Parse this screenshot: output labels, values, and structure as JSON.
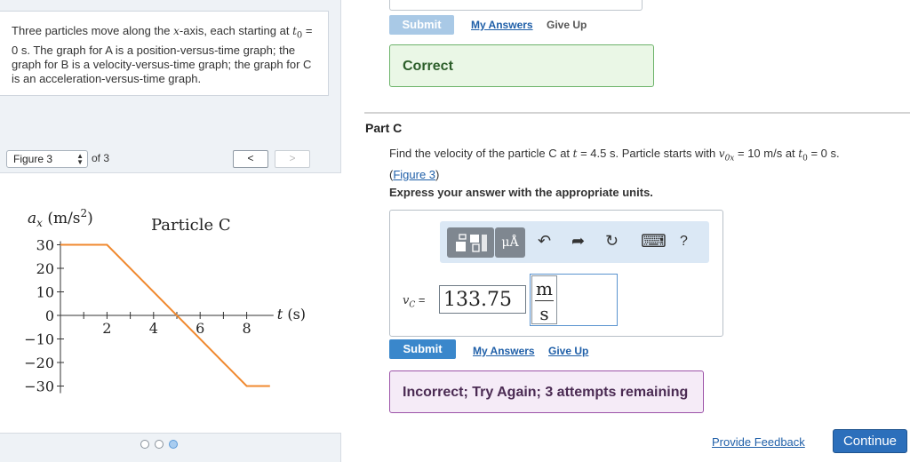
{
  "problem": {
    "text_line1": "Three particles move along the ",
    "x_axis_symbol": "x",
    "text_line1b": "-axis, each starting at ",
    "t0_symbol": "t",
    "t0_sub": "0",
    "text_rest": "= 0 s. The graph for A is a position-versus-time graph; the graph for B is a velocity-versus-time graph; the graph for C is an acceleration-versus-time graph."
  },
  "figure_nav": {
    "selected": "Figure 3",
    "of_label": "of 3",
    "prev_glyph": "<",
    "next_glyph": ">",
    "page_dots": 3,
    "active_dot": 3
  },
  "chart_data": {
    "type": "line",
    "title": "Particle C",
    "ylabel_symbol": "a",
    "ylabel_sub": "x",
    "ylabel_units": "(m/s",
    "ylabel_exp": "2",
    "ylabel_close": ")",
    "xlabel": "t (s)",
    "x_ticks": [
      "2",
      "4",
      "6",
      "8"
    ],
    "y_ticks": [
      "30",
      "20",
      "10",
      "0",
      "−10",
      "−20",
      "−30"
    ],
    "xlim": [
      0,
      9
    ],
    "ylim": [
      -30,
      30
    ],
    "series": [
      {
        "x": [
          0,
          2,
          9,
          9
        ],
        "y": [
          30,
          30,
          -30,
          -30
        ],
        "color": "#f0892f"
      }
    ],
    "points": [
      [
        0,
        30
      ],
      [
        2,
        30
      ],
      [
        8,
        -30
      ],
      [
        9,
        -30
      ]
    ]
  },
  "previous_part": {
    "submit_label": "Submit",
    "my_answers": "My Answers",
    "give_up": "Give Up",
    "result": "Correct"
  },
  "part": {
    "label": "Part C",
    "q_before": "Find the velocity of the particle C at ",
    "q_t": "t",
    "q_mid": " = 4.5 s. Particle starts with ",
    "q_v": "v",
    "q_vsub": "0x",
    "q_after": " = 10 m/s at ",
    "q_t0": "t",
    "q_t0sub": "0",
    "q_end": " = 0 s.",
    "figure_link": "Figure 3",
    "instructions": "Express your answer with the appropriate units."
  },
  "toolbar": {
    "units_label": "μÅ",
    "undo": "↶",
    "redo": "➦",
    "reset": "↻",
    "keyboard": "⌨",
    "help": "?"
  },
  "answer": {
    "var_symbol": "v",
    "var_sub": "C",
    "equals": "=",
    "value": "133.75",
    "unit_num": "m",
    "unit_den": "s"
  },
  "current": {
    "submit_label": "Submit",
    "my_answers": "My Answers",
    "give_up": "Give Up",
    "result": "Incorrect; Try Again; 3 attempts remaining"
  },
  "footer": {
    "feedback": "Provide Feedback",
    "continue": "Continue"
  }
}
